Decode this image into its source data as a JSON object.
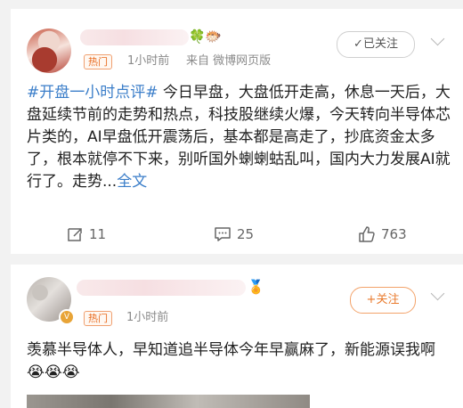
{
  "posts": [
    {
      "hot_tag": "热门",
      "time": "1小时前",
      "source": "来自 微博网页版",
      "follow_label": "已关注",
      "topic": "#开盘一小时点评#",
      "body": " 今日早盘，大盘低开走高，休息一天后，大盘延续节前的走势和热点，科技股继续火爆，今天转向半导体芯片类的，AI早盘低开震荡后，基本都是高走了，抄底资金太多了，根本就停不下来，别听国外蝲蝲蛄乱叫，国内大力发展AI就行了。走势...",
      "more_label": "全文",
      "reposts": "11",
      "comments": "25",
      "likes": "763"
    },
    {
      "hot_tag": "热门",
      "time": "1小时前",
      "follow_label": "+关注",
      "body": "羡慕半导体人，早知道追半导体今年早赢麻了，新能源误我啊😭😭😭"
    }
  ]
}
